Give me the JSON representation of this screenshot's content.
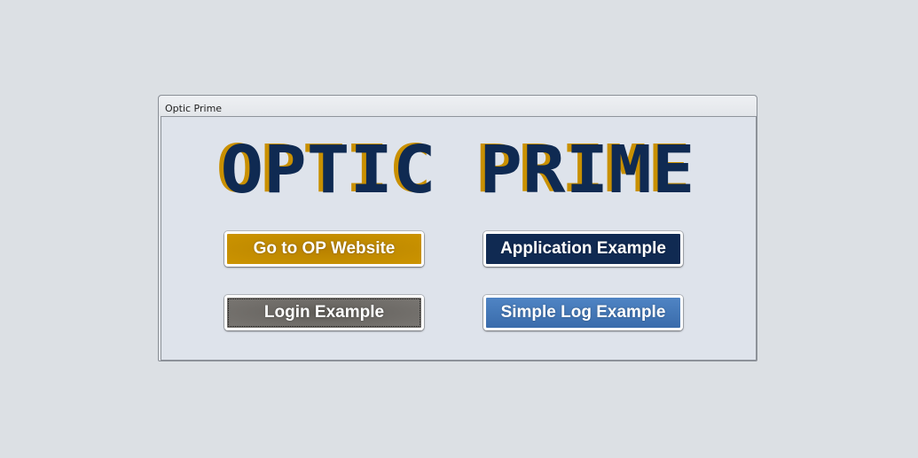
{
  "window": {
    "title": "Optic Prime"
  },
  "logo": {
    "text": "OPTIC PRIME",
    "colors": {
      "primary": "#0f2a52",
      "shadow": "#c99000"
    }
  },
  "buttons": {
    "website_label": "Go to OP Website",
    "application_label": "Application Example",
    "login_label": "Login Example",
    "log_label": "Simple Log Example"
  },
  "colors": {
    "gold": "#c18b00",
    "navy": "#102a52",
    "gray": "#6d6a66",
    "blue": "#3f74b6"
  }
}
